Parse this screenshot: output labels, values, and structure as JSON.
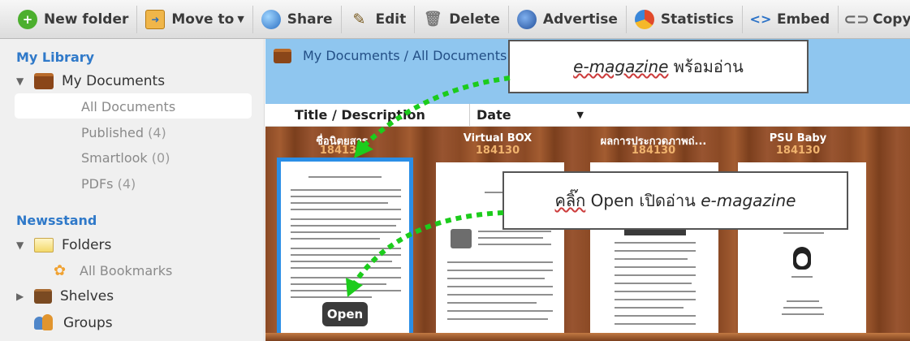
{
  "toolbar": {
    "new_folder": "New folder",
    "move_to": "Move to",
    "share": "Share",
    "edit": "Edit",
    "delete": "Delete",
    "advertise": "Advertise",
    "statistics": "Statistics",
    "embed": "Embed",
    "copy_link": "Copy lin"
  },
  "sidebar": {
    "my_library": "My Library",
    "my_documents": "My Documents",
    "all_documents": "All Documents",
    "published": "Published",
    "published_count": "(4)",
    "smartlook": "Smartlook",
    "smartlook_count": "(0)",
    "pdfs": "PDFs",
    "pdfs_count": "(4)",
    "newsstand": "Newsstand",
    "folders": "Folders",
    "all_bookmarks": "All Bookmarks",
    "shelves": "Shelves",
    "groups": "Groups"
  },
  "breadcrumb": "My Documents / All Documents",
  "columns": {
    "title": "Title / Description",
    "date": "Date"
  },
  "books": [
    {
      "title": "ชื่อนิตยสาร",
      "id": "184130"
    },
    {
      "title": "Virtual BOX",
      "id": "184130"
    },
    {
      "title": "ผลการประกวดภาพถ่...",
      "id": "184130"
    },
    {
      "title": "PSU Baby",
      "id": "184130"
    }
  ],
  "open_button": "Open",
  "callouts": {
    "top_prefix": "e-magazine",
    "top_suffix": " พร้อมอ่าน",
    "mid_prefix": "คลิ๊ก",
    "mid_middle": " Open เปิดอ่าน ",
    "mid_suffix": "e-magazine"
  },
  "colors": {
    "accent": "#2f79c9",
    "breadcrumb_bg": "#8fc6ef",
    "selection_border": "#2a8ee6",
    "arrow_green": "#1ccc1c",
    "shelf_wood": "#8b4a25"
  },
  "icons": {
    "new_folder": "plus-circle-icon",
    "move_to": "move-folder-icon",
    "share": "globe-icon",
    "edit": "pencil-icon",
    "delete": "trash-icon",
    "advertise": "globe-icon",
    "statistics": "pie-chart-icon",
    "embed": "code-brackets-icon",
    "copy_link": "link-icon"
  }
}
